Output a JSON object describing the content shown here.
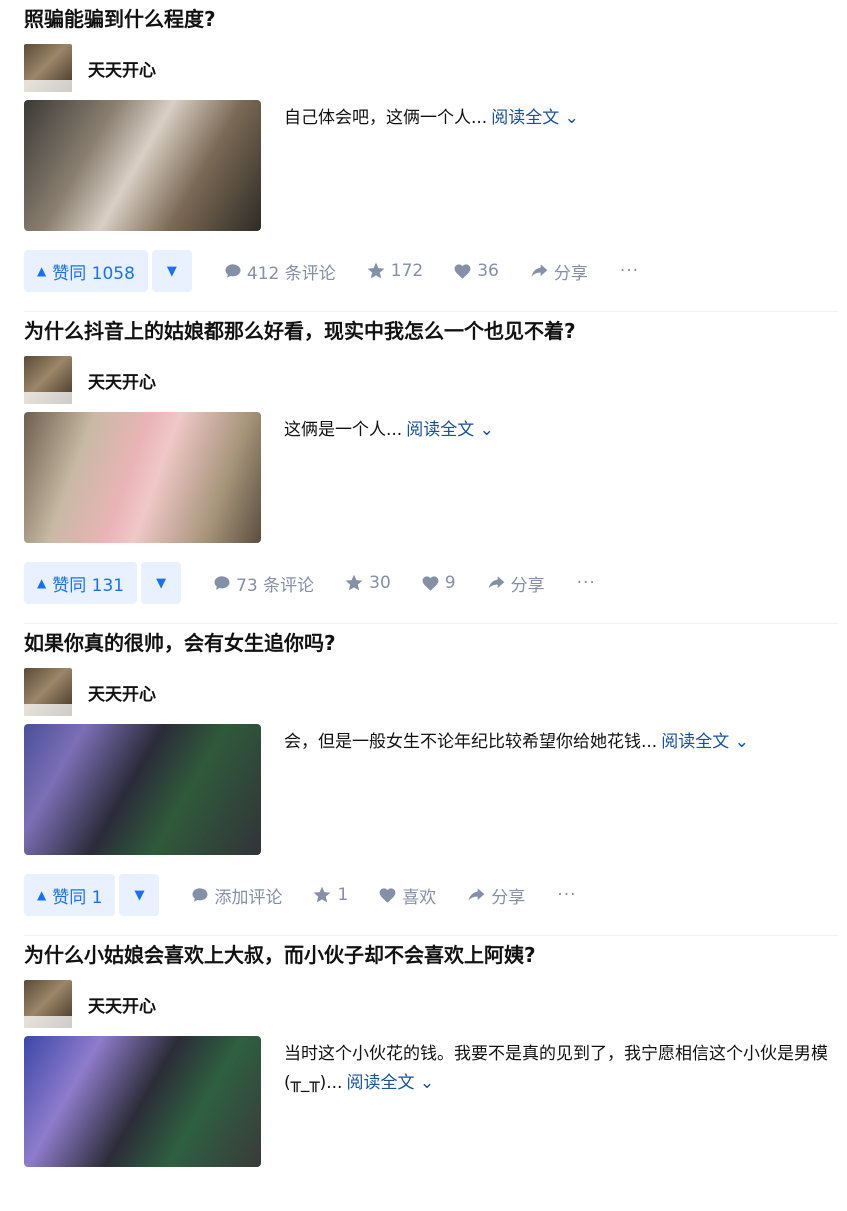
{
  "answers": [
    {
      "question": "照骗能骗到什么程度?",
      "author": "天天开心",
      "excerpt": "自己体会吧，这俩一个人...",
      "read_more": "阅读全文 ⌄",
      "upvote": "赞同 1058",
      "comments": "412 条评论",
      "favorites": "172",
      "likes": "36",
      "share": "分享",
      "more": "···"
    },
    {
      "question": "为什么抖音上的姑娘都那么好看，现实中我怎么一个也见不着?",
      "author": "天天开心",
      "excerpt": "这俩是一个人...",
      "read_more": "阅读全文 ⌄",
      "upvote": "赞同 131",
      "comments": "73 条评论",
      "favorites": "30",
      "likes": "9",
      "share": "分享",
      "more": "···"
    },
    {
      "question": "如果你真的很帅，会有女生追你吗?",
      "author": "天天开心",
      "excerpt": "会，但是一般女生不论年纪比较希望你给她花钱...",
      "read_more": "阅读全文 ⌄",
      "upvote": "赞同 1",
      "comments": "添加评论",
      "favorites": "1",
      "likes": "喜欢",
      "share": "分享",
      "more": "···"
    },
    {
      "question": "为什么小姑娘会喜欢上大叔，而小伙子却不会喜欢上阿姨?",
      "author": "天天开心",
      "excerpt": "当时这个小伙花的钱。我要不是真的见到了，我宁愿相信这个小伙是男模(╥_╥)...",
      "read_more": "阅读全文 ⌄"
    }
  ],
  "icons": {
    "upvote": "triangle-up-icon",
    "downvote": "triangle-down-icon",
    "comment": "comment-bubble-icon",
    "favorite": "star-icon",
    "like": "heart-icon",
    "share": "share-arrow-icon"
  },
  "colors": {
    "accent": "#1772f6",
    "accent_bg": "#e8f1fd",
    "link": "#175199",
    "muted": "#8590a6"
  }
}
